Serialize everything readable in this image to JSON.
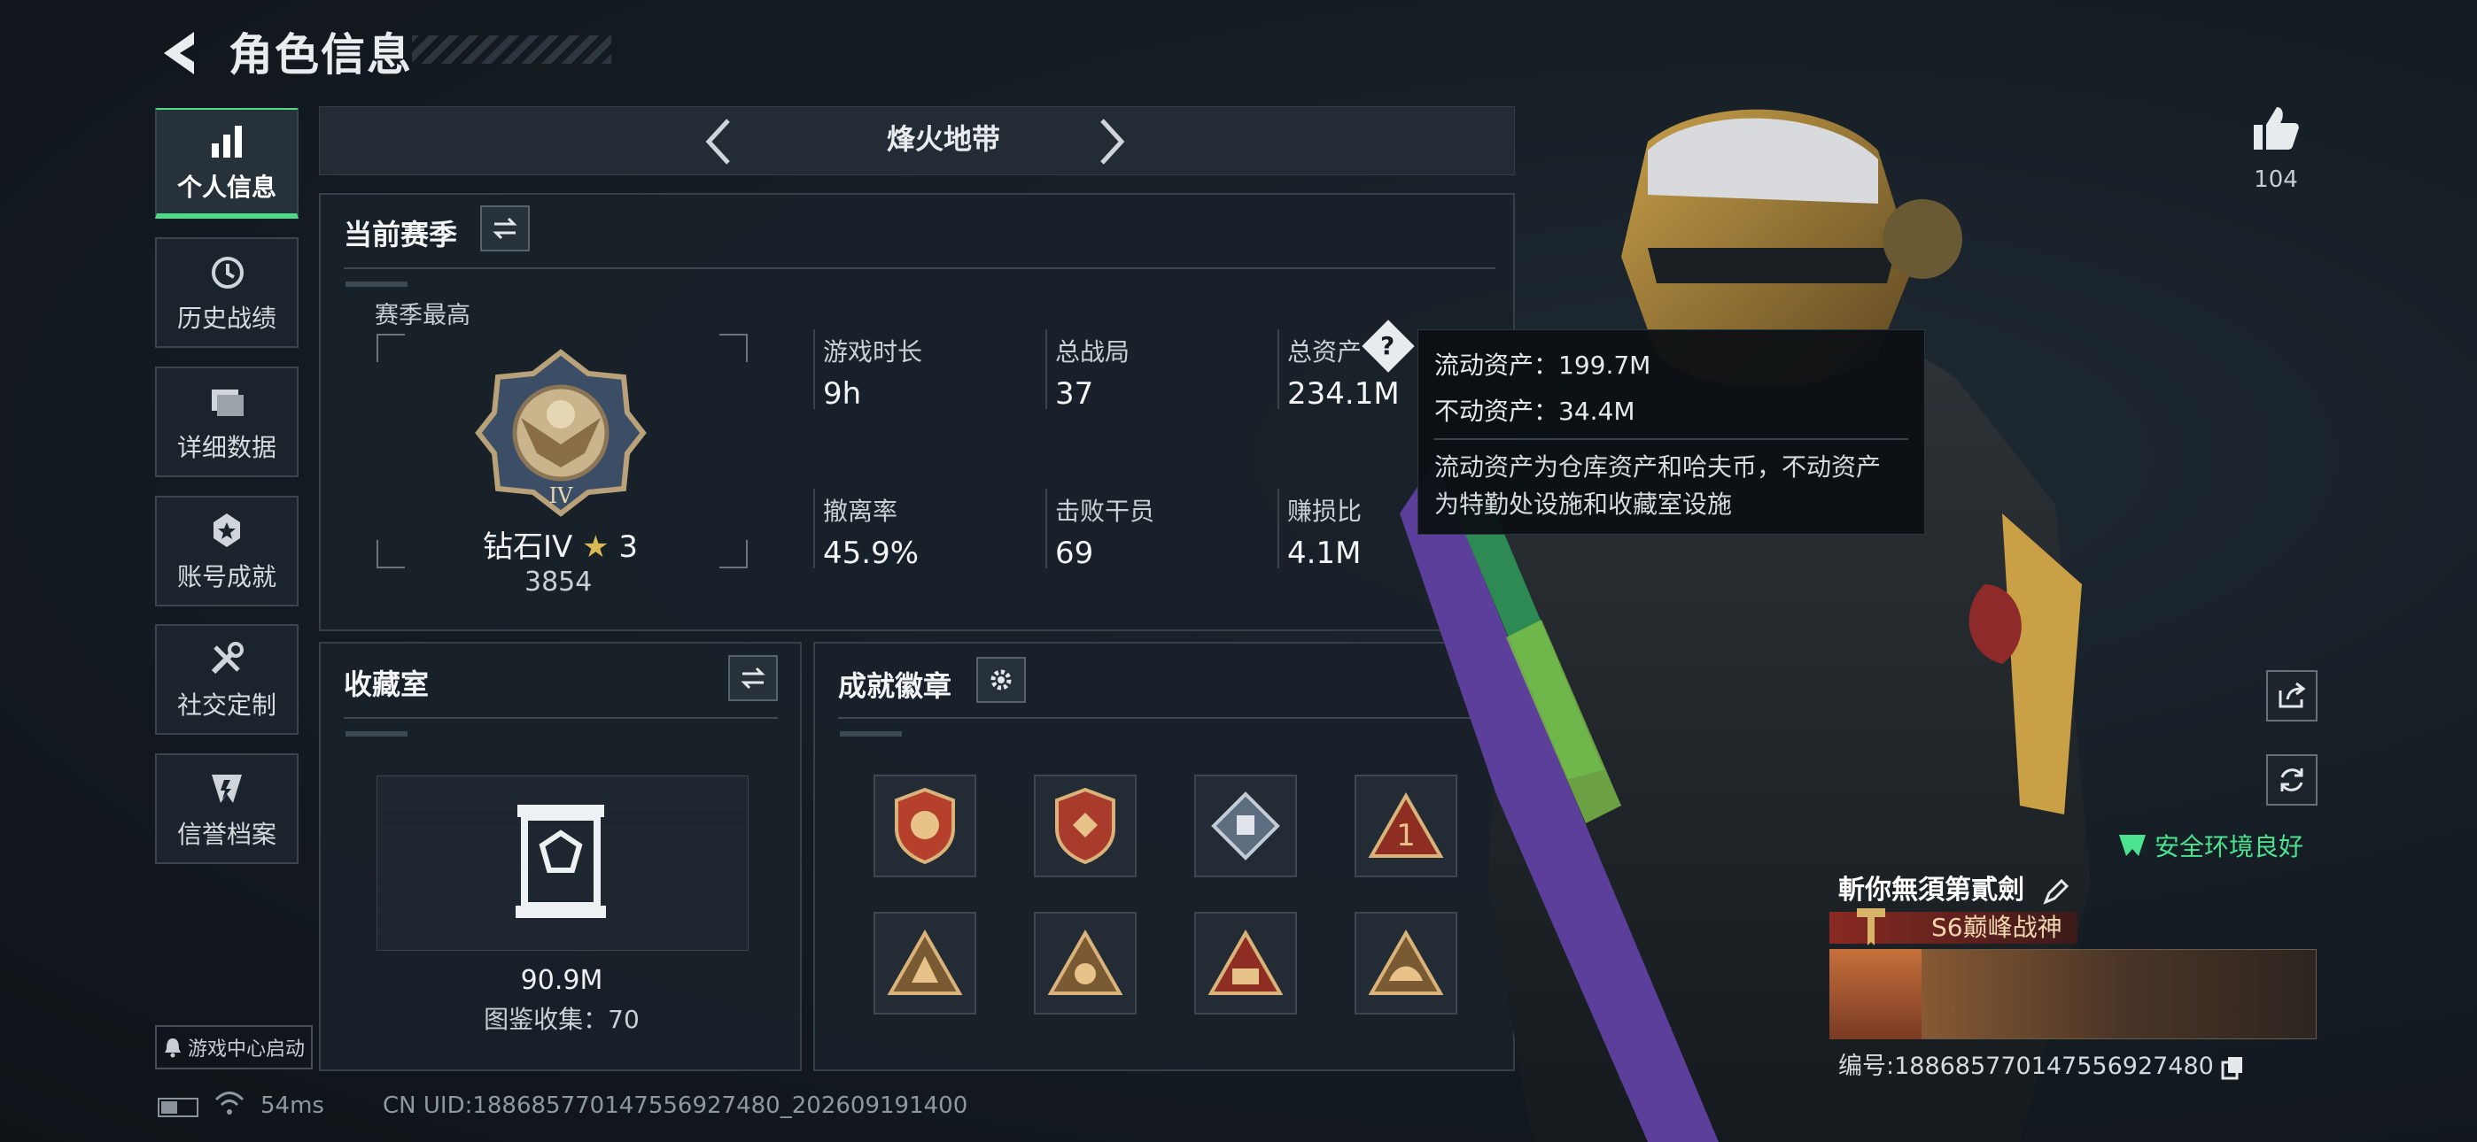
{
  "header": {
    "title": "角色信息"
  },
  "nav": [
    {
      "label": "个人信息",
      "icon": "bar-chart-icon",
      "active": true
    },
    {
      "label": "历史战绩",
      "icon": "history-icon",
      "active": false
    },
    {
      "label": "详细数据",
      "icon": "folder-icon",
      "active": false
    },
    {
      "label": "账号成就",
      "icon": "achievement-icon",
      "active": false
    },
    {
      "label": "社交定制",
      "icon": "tools-icon",
      "active": false
    },
    {
      "label": "信誉档案",
      "icon": "credit-icon",
      "active": false
    }
  ],
  "mode": {
    "title": "烽火地带"
  },
  "season": {
    "title": "当前赛季",
    "best_label": "赛季最高",
    "rank_name": "钻石IV",
    "rank_stars": "3",
    "rank_points": "3854",
    "stats": [
      {
        "label": "游戏时长",
        "value": "9h"
      },
      {
        "label": "总战局",
        "value": "37"
      },
      {
        "label": "总资产",
        "value": "234.1M"
      },
      {
        "label": "撤离率",
        "value": "45.9%"
      },
      {
        "label": "击败干员",
        "value": "69"
      },
      {
        "label": "赚损比",
        "value": "4.1M"
      }
    ]
  },
  "tooltip": {
    "liquid": "流动资产：199.7M",
    "fixed": "不动资产：34.4M",
    "desc1": "流动资产为仓库资产和哈夫币，不动资产",
    "desc2": "为特勤处设施和收藏室设施"
  },
  "vault": {
    "title": "收藏室",
    "value": "90.9M",
    "collection": "图鉴收集：70"
  },
  "badges": {
    "title": "成就徽章",
    "items": [
      "badge-shield-1",
      "badge-shield-2",
      "badge-diamond",
      "badge-triangle-1",
      "badge-triangle-2",
      "badge-triangle-3",
      "badge-triangle-s6",
      "badge-triangle-4"
    ]
  },
  "right": {
    "like_count": "104",
    "safe_text": "安全环境良好",
    "player_name": "斬你無須第貳劍",
    "title_badge": "S6巅峰战神",
    "player_id": "编号:1886857701475569274​80"
  },
  "footer": {
    "game_center": "游戏中心启动",
    "ping": "54ms",
    "uid": "CN UID:1886857701475569274​80_202609191400"
  },
  "colors": {
    "accent": "#4ddb8a",
    "background": "#141b22",
    "panel": "#19212a"
  }
}
